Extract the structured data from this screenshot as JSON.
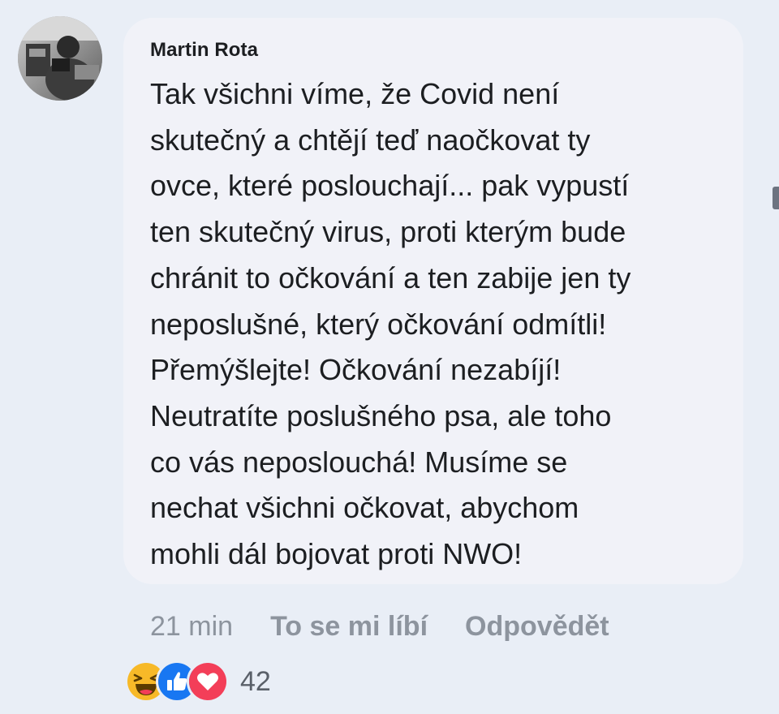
{
  "comment": {
    "author": "Martin Rota",
    "text_lines": [
      "Tak všichni víme, že Covid není",
      "skutečný a chtějí teď naočkovat ty",
      "ovce, které poslouchají... pak vypustí",
      "ten skutečný virus, proti kterým bude",
      "chránit to očkování a ten zabije jen ty",
      "neposlušné, který očkování odmítli!",
      "Přemýšlejte! Očkování nezabíjí!",
      "Neutratíte poslušného psa, ale toho",
      "co vás neposlouchá! Musíme se",
      "nechat všichni očkovat, abychom",
      "mohli dál bojovat proti NWO!"
    ]
  },
  "actions": {
    "time": "21 min",
    "like_label": "To se mi líbí",
    "reply_label": "Odpovědět"
  },
  "reactions": {
    "icons": [
      "haha-reaction-icon",
      "like-reaction-icon",
      "love-reaction-icon"
    ],
    "count": "42"
  },
  "colors": {
    "background": "#e9eef6",
    "bubble": "#f1f2f8",
    "text": "#1c1e21",
    "muted": "#8d949e",
    "like_blue": "#1877f2",
    "love_red": "#f33e58",
    "haha_yellow": "#f7b928"
  }
}
